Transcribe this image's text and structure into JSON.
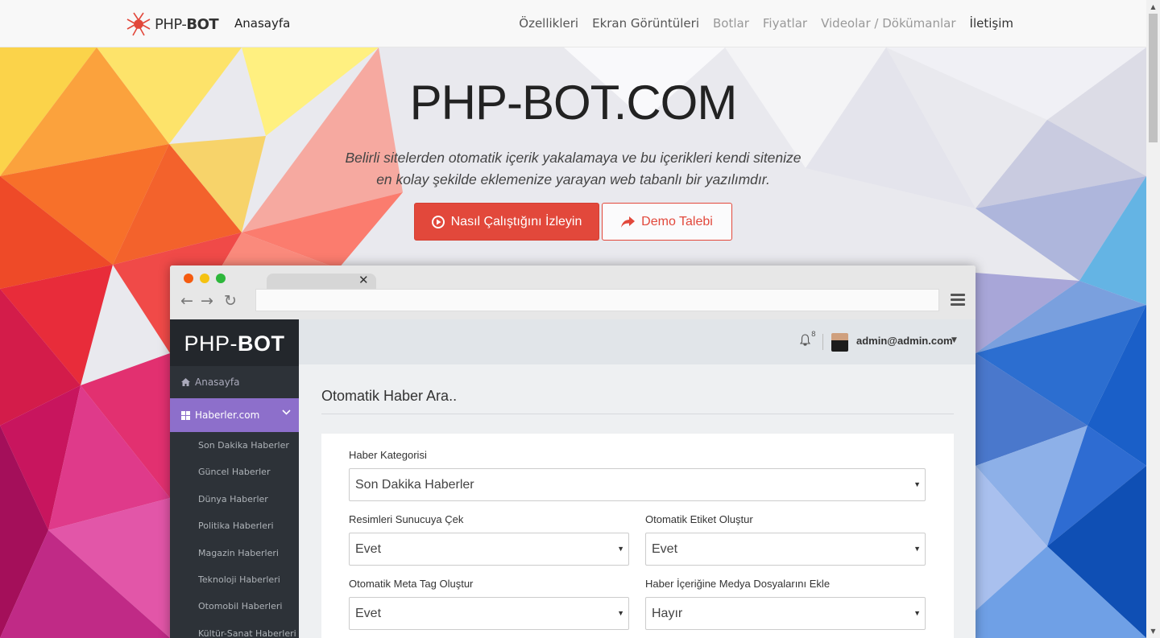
{
  "navbar": {
    "brand_prefix": "PHP-",
    "brand_suffix": "BOT",
    "home": "Anasayfa",
    "links": [
      {
        "label": "Özellikleri"
      },
      {
        "label": "Ekran Görüntüleri"
      },
      {
        "label": "Botlar"
      },
      {
        "label": "Fiyatlar"
      },
      {
        "label": "Videolar / Dökümanlar"
      },
      {
        "label": "İletişim"
      }
    ]
  },
  "hero": {
    "title": "PHP-BOT.COM",
    "subtitle_line1": "Belirli sitelerden otomatik içerik yakalamaya ve bu içerikleri kendi sitenize",
    "subtitle_line2": "en kolay şekilde eklemenize yarayan web tabanlı bir yazılımdır.",
    "primary_button": "Nasıl Çalıştığını İzleyin",
    "secondary_button": "Demo Talebi"
  },
  "app": {
    "logo_prefix": "PHP-",
    "logo_suffix": "BOT",
    "sidebar_home": "Anasayfa",
    "sidebar_active": "Haberler.com",
    "sub_items": [
      "Son Dakika Haberler",
      "Güncel Haberler",
      "Dünya Haberler",
      "Politika Haberleri",
      "Magazin Haberleri",
      "Teknoloji Haberleri",
      "Otomobil Haberleri",
      "Kültür-Sanat Haberleri"
    ],
    "notification_count": "8",
    "user_email": "admin@admin.com",
    "page_title": "Otomatik Haber Ara..",
    "fields": {
      "category_label": "Haber Kategorisi",
      "category_value": "Son Dakika Haberler",
      "images_label": "Resimleri Sunucuya Çek",
      "images_value": "Evet",
      "tags_label": "Otomatik Etiket Oluştur",
      "tags_value": "Evet",
      "meta_label": "Otomatik Meta Tag Oluştur",
      "meta_value": "Evet",
      "media_label": "Haber İçeriğine Medya Dosyalarını Ekle",
      "media_value": "Hayır"
    }
  },
  "colors": {
    "accent_red": "#e2483b",
    "sidebar_active": "#8d6fcb",
    "sidebar_bg": "#2d3238"
  }
}
